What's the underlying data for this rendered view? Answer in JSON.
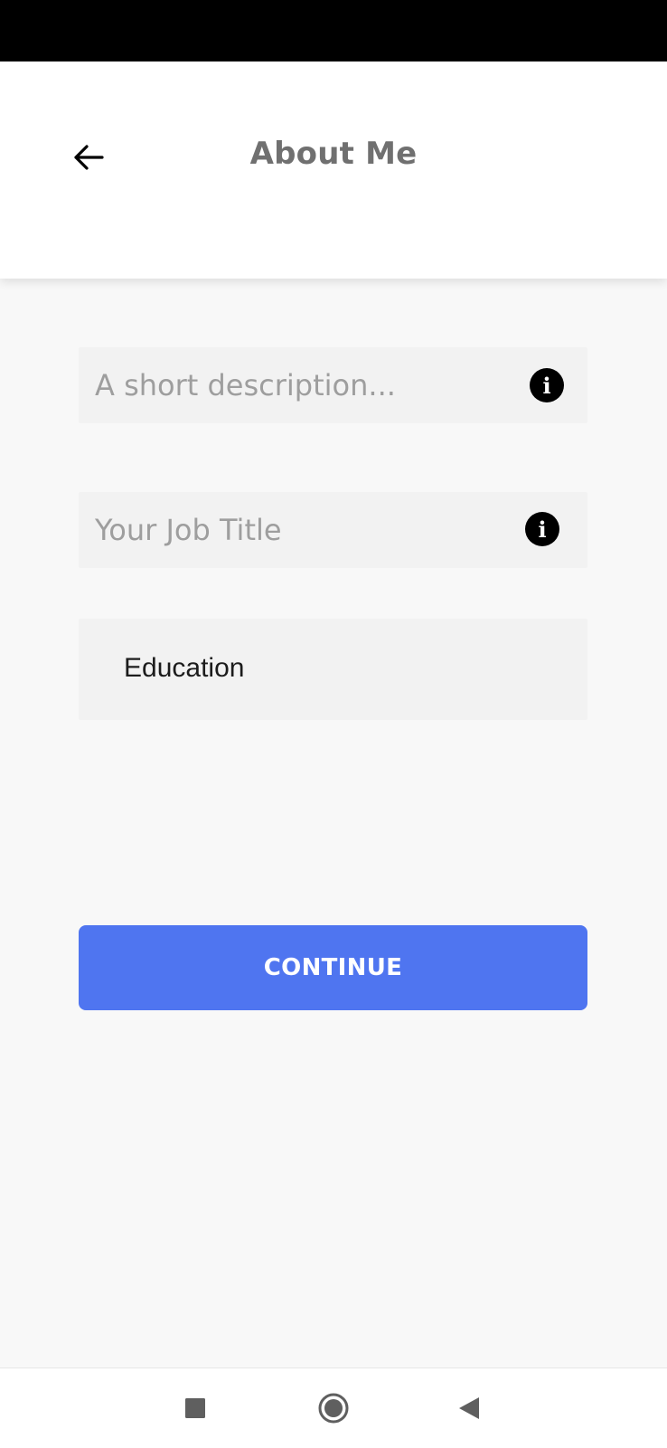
{
  "header": {
    "title": "About Me",
    "back_icon": "arrow-left-icon"
  },
  "form": {
    "description_placeholder": "A short description...",
    "description_value": "",
    "job_title_placeholder": "Your Job Title",
    "job_title_value": "",
    "education_label": "Education",
    "info_icon": "info-icon"
  },
  "actions": {
    "continue_label": "CONTINUE"
  },
  "system_nav": {
    "recent_icon": "square-icon",
    "home_icon": "circle-icon",
    "back_icon": "triangle-back-icon"
  },
  "colors": {
    "status_bar": "#000000",
    "primary_button": "#4f75f0",
    "title_text": "#707070",
    "field_background": "#f2f2f2",
    "page_background": "#f8f8f8"
  }
}
